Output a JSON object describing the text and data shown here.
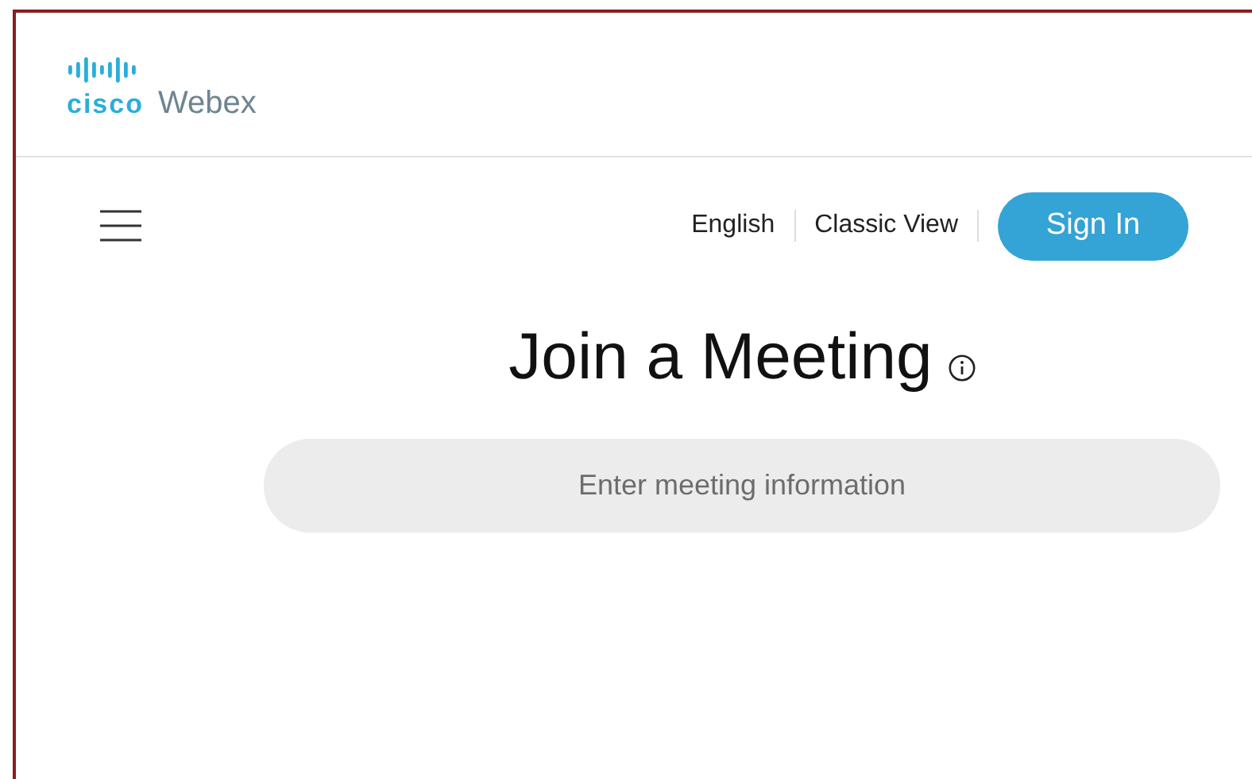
{
  "logo": {
    "brand": "cisco",
    "product": "Webex"
  },
  "nav": {
    "links": [
      {
        "label": "English"
      },
      {
        "label": "Classic View"
      }
    ],
    "sign_in": "Sign In"
  },
  "join": {
    "title": "Join a Meeting",
    "field": {
      "placeholder": "Enter meeting information"
    }
  }
}
